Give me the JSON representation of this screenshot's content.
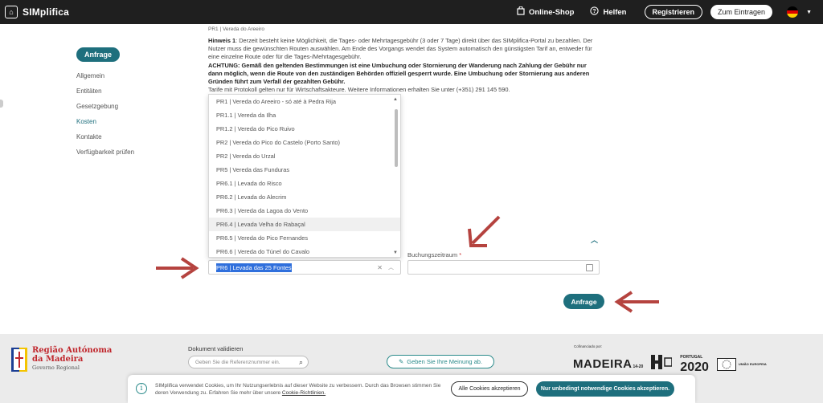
{
  "header": {
    "logo_text": "SIMplifica",
    "online_shop": "Online-Shop",
    "help": "Helfen",
    "register": "Registrieren",
    "login": "Zum Eintragen"
  },
  "sidebar": {
    "active_pill": "Anfrage",
    "items": [
      "Allgemein",
      "Entitäten",
      "Gesetzgebung",
      "Kosten",
      "Kontakte",
      "Verfügbarkeit prüfen"
    ]
  },
  "content": {
    "cut_line": "PR1 | Vereda do Areeiro",
    "hint_label": "Hinweis 1",
    "hint_text": ": Derzeit besteht keine Möglichkeit, die Tages- oder Mehrtagesgebühr (3 oder 7 Tage) direkt über das SIMplifica-Portal zu bezahlen. Der Nutzer muss die gewünschten Routen auswählen. Am Ende des Vorgangs wendet das System automatisch den günstigsten Tarif an, entweder für eine einzelne Route oder für die Tages-/Mehrtagesgebühr.",
    "attention_text": "ACHTUNG: Gemäß den geltenden Bestimmungen ist eine Umbuchung oder Stornierung der Wanderung nach Zahlung der Gebühr nur dann möglich, wenn die Route von den zuständigen Behörden offiziell gesperrt wurde. Eine Umbuchung oder Stornierung aus anderen Gründen führt zum Verfall der gezahlten Gebühr.",
    "partial_line": "Tarife mit Protokoll gelten nur für Wirtschaftsakteure. Weitere Informationen erhalten Sie unter (+351) 291 145 590."
  },
  "route_dropdown": {
    "options": [
      "PR1 | Vereda do Areeiro - só até à Pedra Rija",
      "PR1.1 | Vereda da Ilha",
      "PR1.2 | Vereda do Pico Ruivo",
      "PR2 | Vereda do Pico do Castelo (Porto Santo)",
      "PR2 | Vereda do Urzal",
      "PR5 | Vereda das Funduras",
      "PR6.1 | Levada do Risco",
      "PR6.2 | Levada do Alecrim",
      "PR6.3 | Vereda da Lagoa do Vento",
      "PR6.4 | Levada Velha do Rabaçal",
      "PR6.5 | Vereda do Pico Fernandes",
      "PR6.6 | Vereda do Túnel do Cavalo"
    ],
    "selected": "PR6 | Levada das 25 Fontes"
  },
  "booking": {
    "label": "Buchungszeitraum",
    "required_mark": "*",
    "submit": "Anfrage"
  },
  "footer": {
    "region_line1": "Região Autónoma",
    "region_line2": "da Madeira",
    "region_line3": "Governo Regional",
    "doc_label": "Dokument validieren",
    "doc_placeholder": "Geben Sie die Referenznummer ein.",
    "feedback": "Geben Sie Ihre Meinung ab.",
    "cofinanced": "Cofinanciado por:",
    "logo_madeira": "MADEIRA",
    "logo_madeira_sub": "14-20",
    "logo_portugal": "2020",
    "logo_portugal_sub": "PORTUGAL",
    "logo_eu_sub": "UNIÃO EUROPEIA"
  },
  "cookie": {
    "text": "SIMplifica verwendet Cookies, um Ihr Nutzungserlebnis auf dieser Website zu verbessern. Durch das Browsen stimmen Sie deren Verwendung zu. Erfahren Sie mehr über unsere",
    "link": "Cookie-Richtlinien.",
    "accept_all": "Alle Cookies akzeptieren",
    "necessary_only": "Nur unbedingt notwendige Cookies akzeptieren."
  },
  "colors": {
    "teal": "#1e6f7d",
    "arrow_red": "#b5433f",
    "header": "#1f1f1f"
  }
}
